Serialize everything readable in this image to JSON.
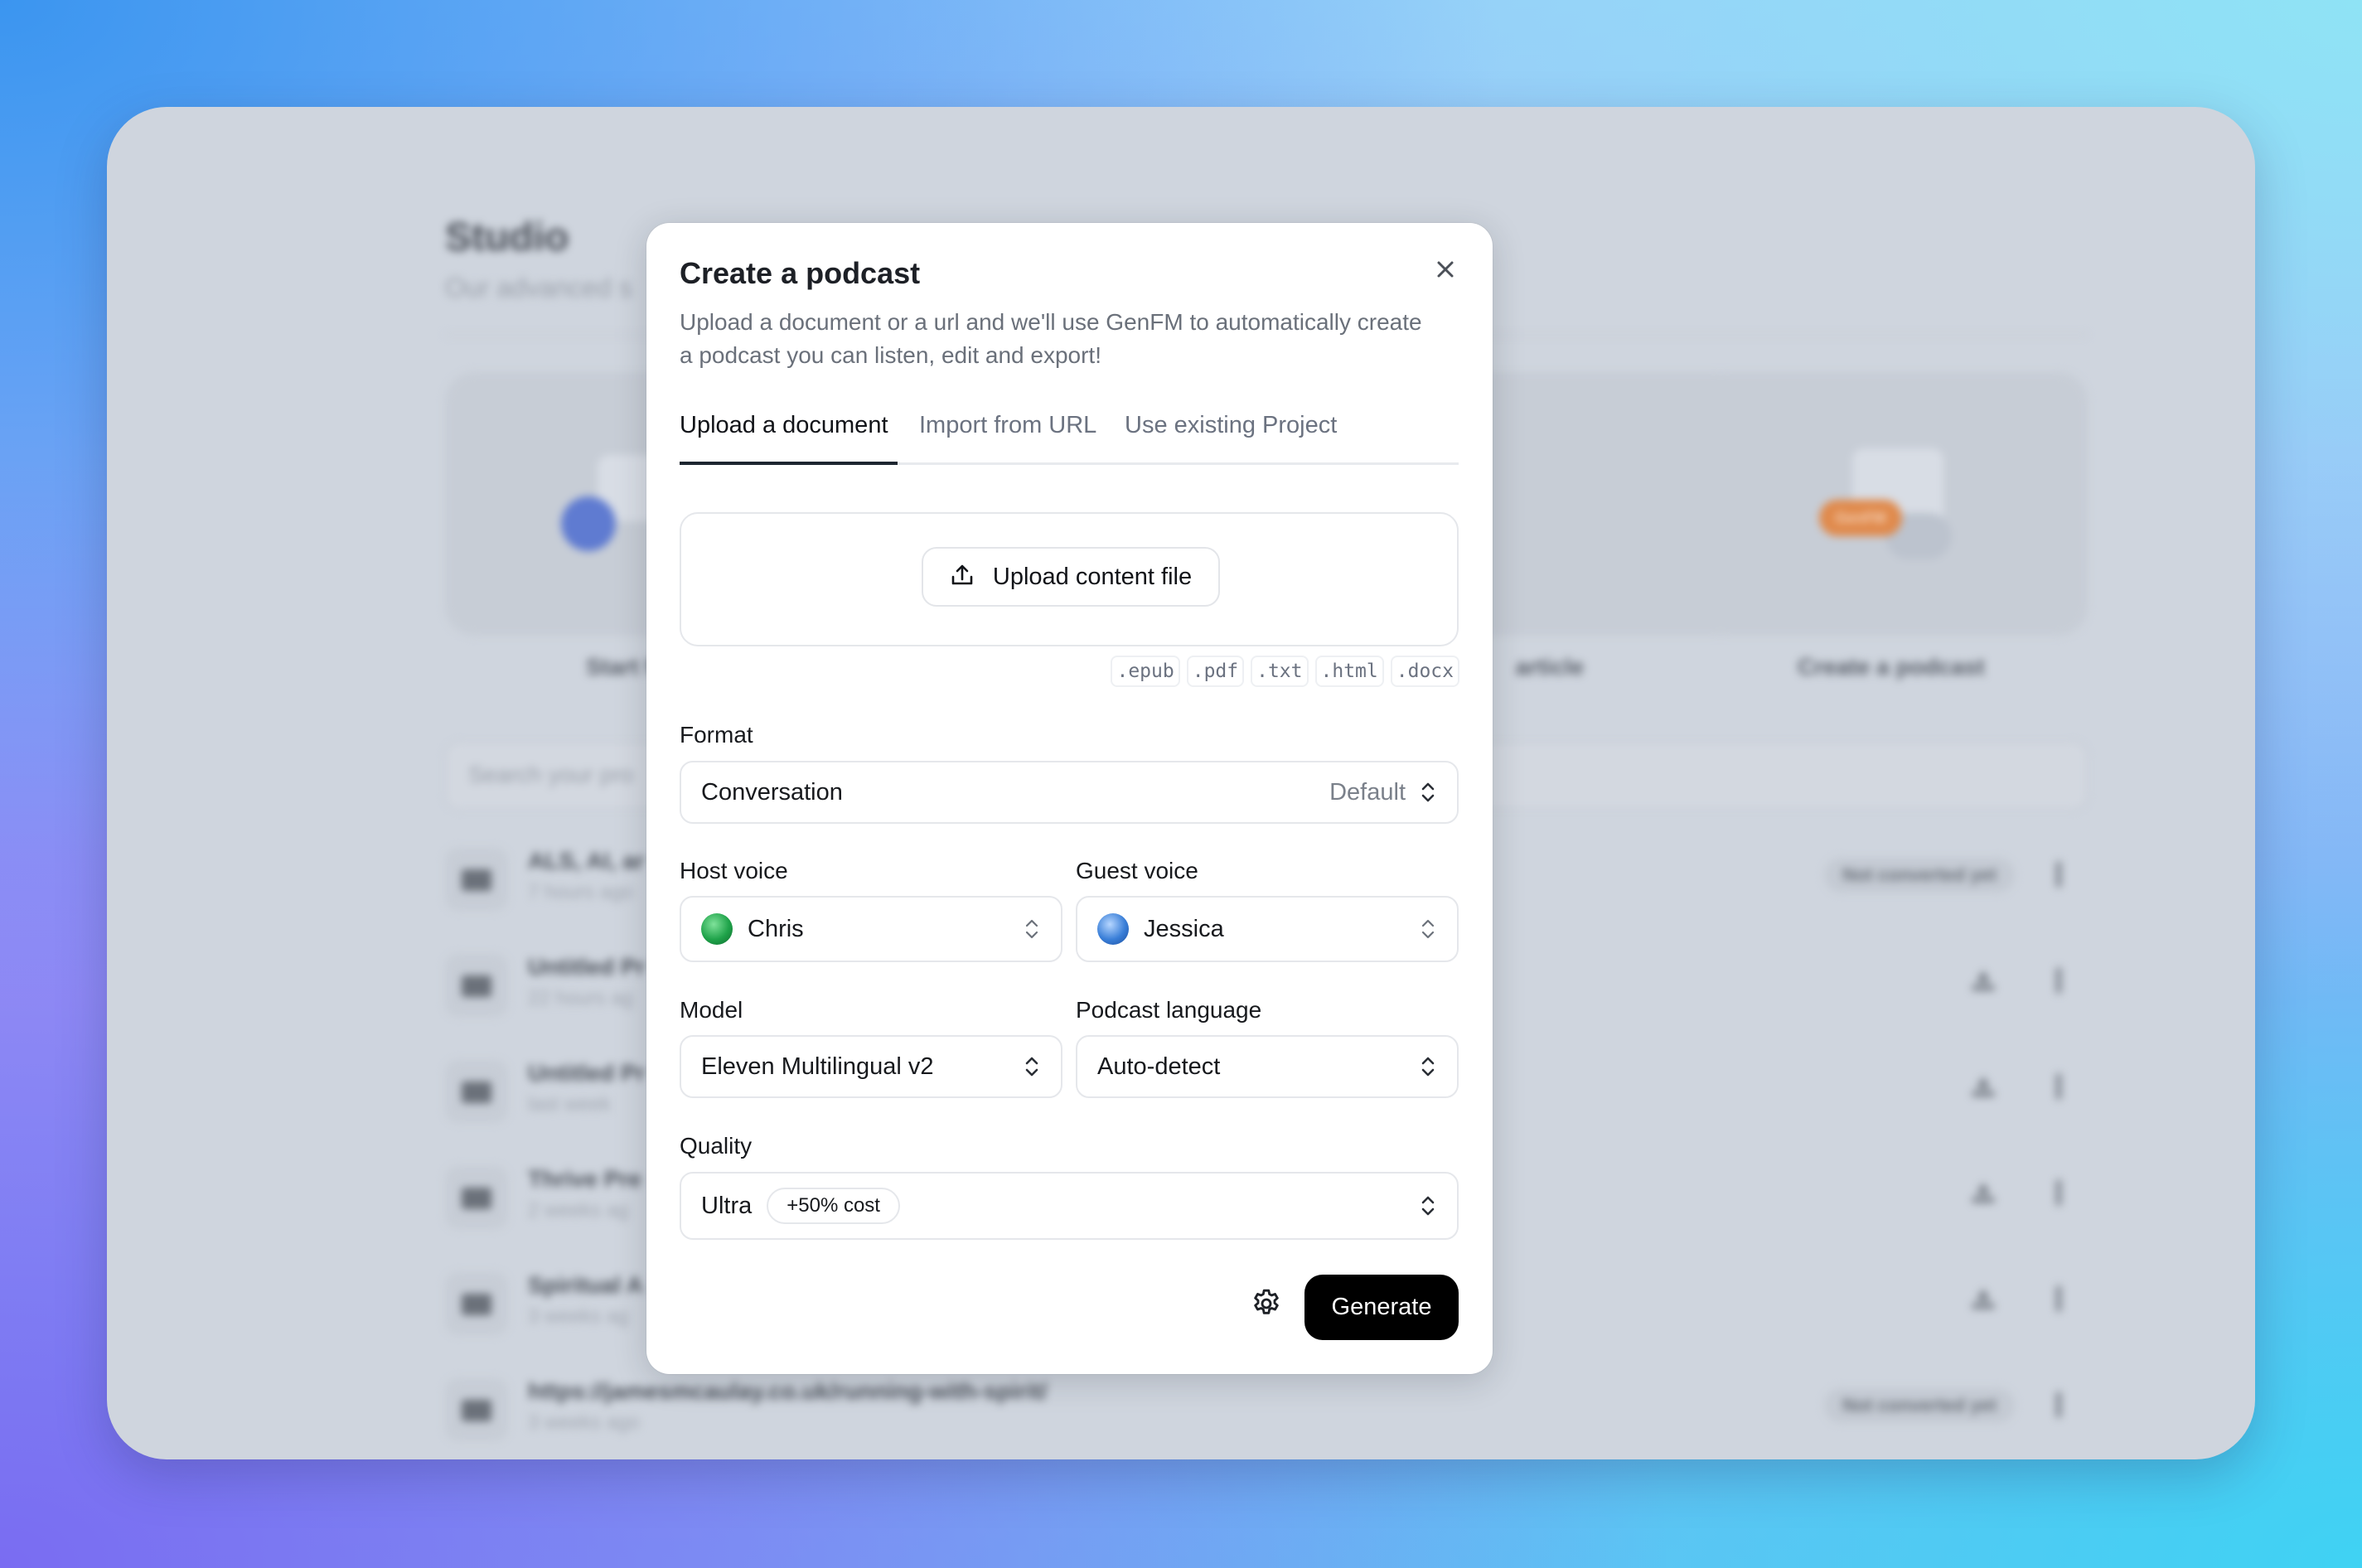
{
  "background_app": {
    "title": "Studio",
    "subtitle": "Our advanced s",
    "tiles": [
      {
        "label": "Start from",
        "accent": "#5f7bd1"
      },
      {
        "label": "",
        "accent": "#5f7bd1"
      },
      {
        "label": "article",
        "accent": "#3cc08a"
      },
      {
        "label": "Create a podcast",
        "accent": "#e08a4c",
        "bubble_text": "GenFM"
      }
    ],
    "search_placeholder": "Search your pro",
    "projects": [
      {
        "title": "ALS, AI, ar",
        "time": "7 hours ago",
        "status": "Not converted yet",
        "downloadable": false
      },
      {
        "title": "Untitled Pr",
        "time": "22 hours ag",
        "status": "",
        "downloadable": true
      },
      {
        "title": "Untitled Pr",
        "time": "last week",
        "status": "",
        "downloadable": true
      },
      {
        "title": "Thrive Pre",
        "time": "2 weeks ag",
        "status": "",
        "downloadable": true
      },
      {
        "title": "Spiritual A",
        "time": "3 weeks ag",
        "status": "",
        "downloadable": true
      },
      {
        "title": "https://jamesmcaulay.co.uk/running-with-spirit/",
        "time": "3 weeks ago",
        "status": "Not converted yet",
        "downloadable": false
      }
    ]
  },
  "modal": {
    "title": "Create a podcast",
    "subtitle": "Upload a document or a url and we'll use GenFM to automatically create a podcast you can listen, edit and export!",
    "close_icon": "close-icon",
    "tabs": [
      {
        "label": "Upload a document",
        "active": true
      },
      {
        "label": "Import from URL",
        "active": false
      },
      {
        "label": "Use existing Project",
        "active": false
      }
    ],
    "upload": {
      "button_label": "Upload content file",
      "icon": "upload-icon",
      "file_types": [
        ".epub",
        ".pdf",
        ".txt",
        ".html",
        ".docx"
      ]
    },
    "format": {
      "label": "Format",
      "value": "Conversation",
      "hint": "Default"
    },
    "host_voice": {
      "label": "Host voice",
      "value": "Chris",
      "avatar_color": "#1fa34a"
    },
    "guest_voice": {
      "label": "Guest voice",
      "value": "Jessica",
      "avatar_color": "#3a7fd8"
    },
    "model": {
      "label": "Model",
      "value": "Eleven Multilingual v2"
    },
    "language": {
      "label": "Podcast language",
      "value": "Auto-detect"
    },
    "quality": {
      "label": "Quality",
      "value": "Ultra",
      "cost_badge": "+50% cost"
    },
    "settings_icon": "gear-icon",
    "generate_label": "Generate"
  }
}
